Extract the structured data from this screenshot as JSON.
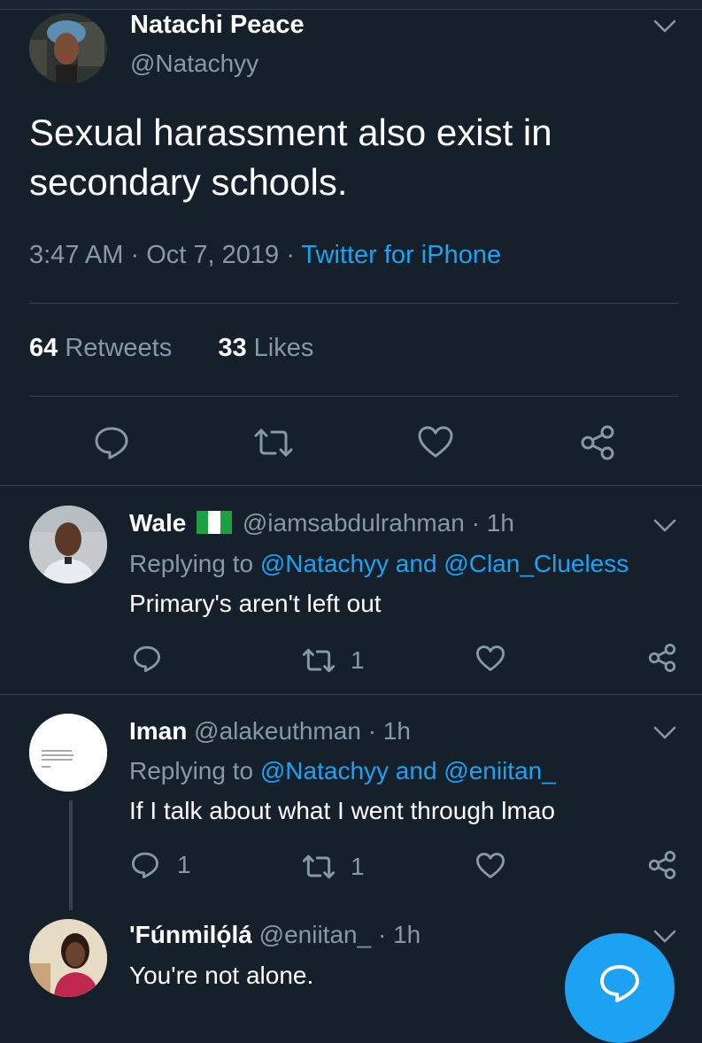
{
  "main_tweet": {
    "author_name": "Natachi Peace",
    "author_handle": "@Natachyy",
    "text_line1": "Sexual harassment also exist in",
    "text_line2": "secondary schools.",
    "time": "3:47 AM",
    "sep1": "·",
    "date": "Oct 7, 2019",
    "sep2": "·",
    "source": "Twitter for iPhone",
    "retweets_count": "64",
    "retweets_label": "Retweets",
    "likes_count": "33",
    "likes_label": "Likes"
  },
  "replies": [
    {
      "name": "Wale",
      "handle": "@iamsabdulrahman",
      "time": "· 1h",
      "replying_prefix": "Replying to",
      "mention1": "@Natachyy",
      "and_word": "and",
      "mention2": "@Clan_Clueless",
      "text": "Primary's aren't left out",
      "reply_count": "",
      "retweet_count": "1"
    },
    {
      "name": "Iman",
      "handle": "@alakeuthman",
      "time": "· 1h",
      "replying_prefix": "Replying to",
      "mention1": "@Natachyy",
      "and_word": "and",
      "mention2": "@eniitan_",
      "text": "If I talk about what I went through lmao",
      "reply_count": "1",
      "retweet_count": "1"
    },
    {
      "name": "'Fúnmilọ́lá",
      "handle": "@eniitan_",
      "time": "· 1h",
      "text": "You're not alone."
    }
  ],
  "icons": {
    "reply": "speech-bubble-icon",
    "retweet": "retweet-arrows-icon",
    "like": "heart-icon",
    "share": "share-nodes-icon",
    "menu": "chevron-down-icon",
    "flag": "nigeria-flag-icon",
    "compose": "compose-reply-icon"
  },
  "colors": {
    "background": "#15202b",
    "accent": "#1da1f2",
    "muted": "#8899a6",
    "divider": "#38444d"
  }
}
